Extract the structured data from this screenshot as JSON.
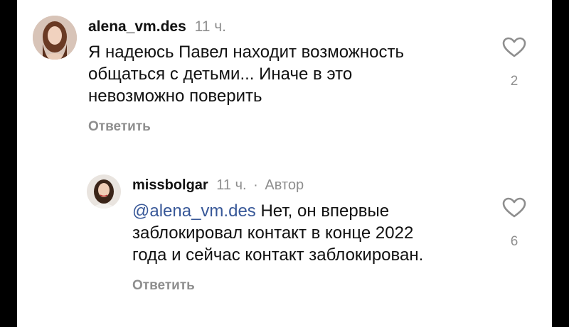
{
  "comments": [
    {
      "username": "alena_vm.des",
      "time": "11 ч.",
      "text": "Я надеюсь Павел находит возможность общаться с детьми... Иначе в это невозможно поверить",
      "line1": "Я надеюсь Павел находит возможность",
      "line2": "общаться с детьми... Иначе в это",
      "line3": "невозможно поверить",
      "reply_label": "Ответить",
      "likes": "2",
      "avatar_icon": "user-photo-avatar",
      "like_icon": "heart-outline-icon"
    },
    {
      "username": "missbolgar",
      "time": "11 ч.",
      "separator": "·",
      "badge": "Автор",
      "mention": "@alena_vm.des",
      "line1_rest": " Нет, он впервые",
      "line2": "заблокировал контакт в конце 2022",
      "line3": "года и сейчас контакт заблокирован.",
      "reply_label": "Ответить",
      "likes": "6",
      "avatar_icon": "user-photo-avatar",
      "like_icon": "heart-outline-icon"
    }
  ],
  "colors": {
    "text": "#111111",
    "secondary": "#8e8e8e",
    "mention": "#385898",
    "background": "#ffffff"
  }
}
